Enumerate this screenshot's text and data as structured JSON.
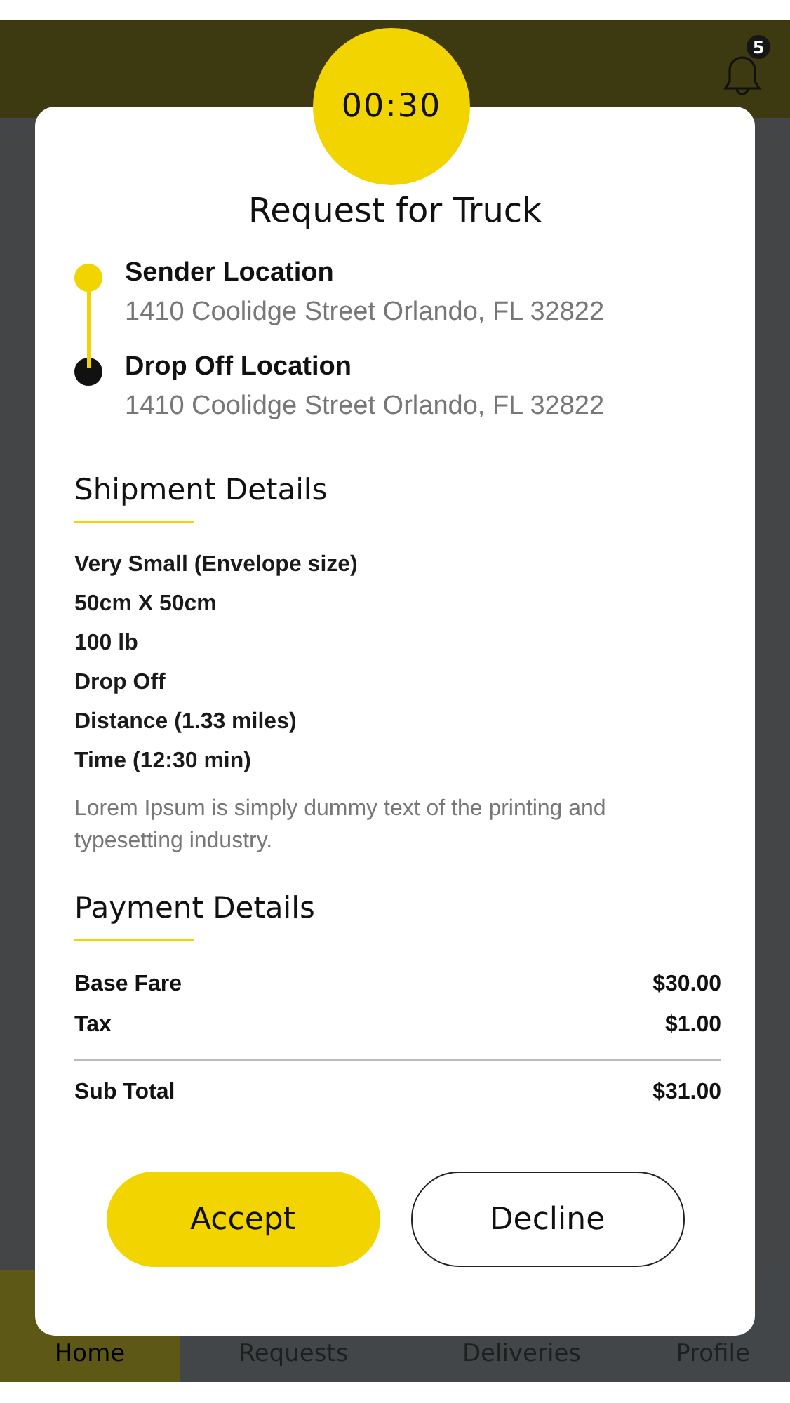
{
  "header": {
    "notification_count": "5"
  },
  "request": {
    "timer": "00:30",
    "title": "Request for Truck",
    "locations": [
      {
        "kind": "start",
        "label": "Sender Location",
        "address": "1410 Coolidge Street Orlando, FL 32822"
      },
      {
        "kind": "end",
        "label": "Drop Off Location",
        "address": "1410 Coolidge Street Orlando, FL 32822"
      }
    ],
    "shipment": {
      "heading": "Shipment Details",
      "lines": [
        "Very Small (Envelope size)",
        "50cm X 50cm",
        "100 lb",
        "Drop Off",
        "Distance (1.33 miles)",
        "Time (12:30 min)"
      ],
      "note": "Lorem Ipsum is simply dummy text of the printing and typesetting industry."
    },
    "payment": {
      "heading": "Payment Details",
      "rows": [
        {
          "kind": "item",
          "label": "Base Fare",
          "amount": "$30.00"
        },
        {
          "kind": "item",
          "label": "Tax",
          "amount": "$1.00"
        },
        {
          "kind": "total",
          "label": "Sub Total",
          "amount": "$31.00"
        }
      ]
    },
    "buttons": [
      {
        "kind": "primary",
        "label": "Accept"
      },
      {
        "kind": "secondary",
        "label": "Decline"
      }
    ]
  },
  "nav": [
    {
      "label": "Home",
      "selected": true
    },
    {
      "label": "Requests",
      "selected": false
    },
    {
      "label": "Deliveries",
      "selected": false
    },
    {
      "label": "Profile",
      "selected": false
    }
  ]
}
